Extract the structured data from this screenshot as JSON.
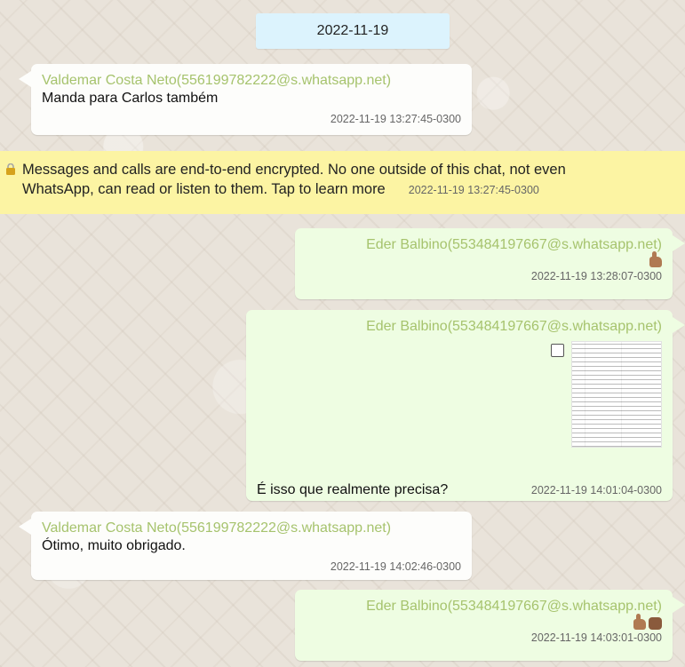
{
  "date_divider": "2022-11-19",
  "messages": [
    {
      "direction": "in",
      "sender": "Valdemar Costa Neto(556199782222@s.whatsapp.net)",
      "text": "Manda para Carlos também",
      "timestamp": "2022-11-19 13:27:45-0300"
    },
    {
      "direction": "out",
      "sender": "Eder Balbino(553484197667@s.whatsapp.net)",
      "emoji": [
        "thumbs-up-medium-dark-skin"
      ],
      "timestamp": "2022-11-19 13:28:07-0300"
    },
    {
      "direction": "out",
      "sender": "Eder Balbino(553484197667@s.whatsapp.net)",
      "attachment": "document-thumbnail",
      "text": "É isso que realmente precisa?",
      "timestamp": "2022-11-19 14:01:04-0300"
    },
    {
      "direction": "in",
      "sender": "Valdemar Costa Neto(556199782222@s.whatsapp.net)",
      "text": "Ótimo, muito obrigado.",
      "timestamp": "2022-11-19 14:02:46-0300"
    },
    {
      "direction": "out",
      "sender": "Eder Balbino(553484197667@s.whatsapp.net)",
      "emoji": [
        "thumbs-up-medium-dark-skin",
        "raised-fist-dark-skin"
      ],
      "timestamp": "2022-11-19 14:03:01-0300"
    }
  ],
  "encryption_notice": {
    "line1": "Messages and calls are end-to-end encrypted. No one outside of this chat, not even",
    "line2": "WhatsApp, can read or listen to them. Tap to learn more",
    "timestamp": "2022-11-19 13:27:45-0300",
    "icon": "lock-icon"
  },
  "colors": {
    "sender_name": "#a6c36d",
    "incoming_bubble": "#fdfdfb",
    "outgoing_bubble": "#eefde2",
    "date_chip": "#dcf3fd",
    "encryption_banner": "#fcf4a3"
  }
}
